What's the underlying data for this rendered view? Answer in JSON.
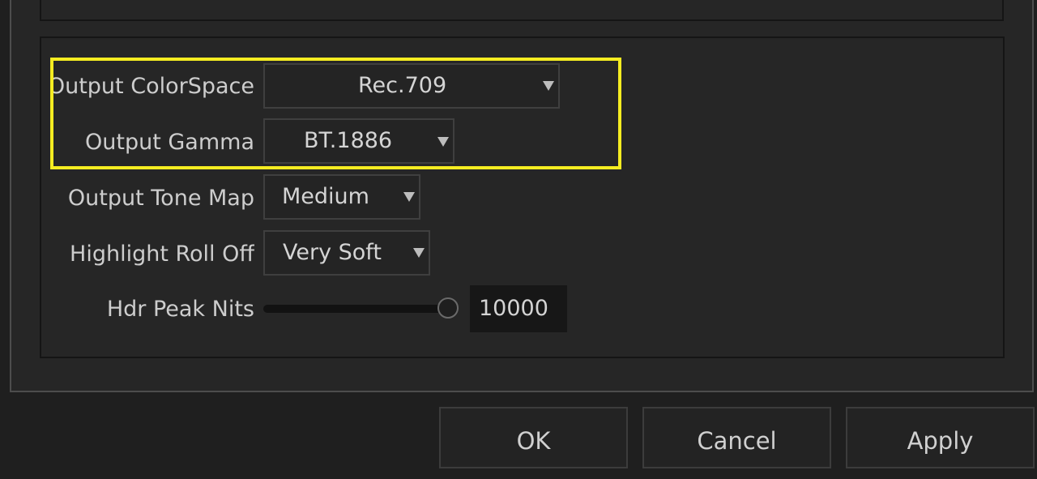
{
  "settings": {
    "output_colorspace": {
      "label": "Output ColorSpace",
      "value": "Rec.709"
    },
    "output_gamma": {
      "label": "Output Gamma",
      "value": "BT.1886"
    },
    "output_tone_map": {
      "label": "Output Tone Map",
      "value": "Medium"
    },
    "highlight_roll_off": {
      "label": "Highlight Roll Off",
      "value": "Very Soft"
    },
    "hdr_peak_nits": {
      "label": "Hdr Peak Nits",
      "value": "10000",
      "slider_level": 1.0
    }
  },
  "buttons": {
    "ok": "OK",
    "cancel": "Cancel",
    "apply": "Apply"
  },
  "colors": {
    "highlight": "#f5ec21",
    "background": "#1f1f1f",
    "panel": "#262626"
  },
  "icons": {
    "dropdown_arrow": "caret-down-icon"
  }
}
